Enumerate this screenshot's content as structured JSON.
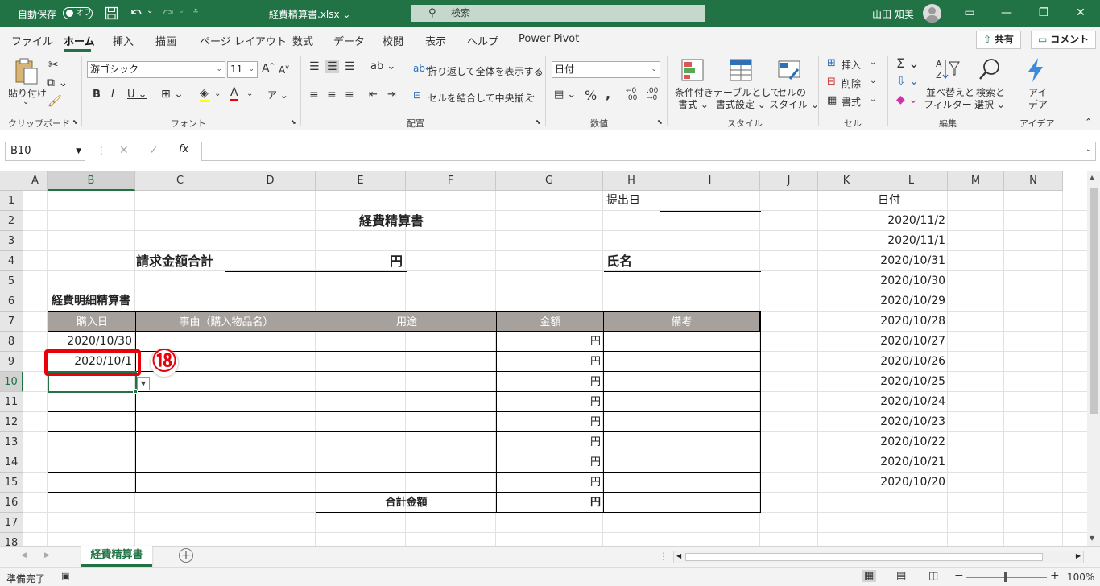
{
  "titlebar": {
    "autosave_label": "自動保存",
    "autosave_state": "オフ",
    "filename": "経費精算書.xlsx ⌄",
    "search_placeholder": "検索",
    "user_name": "山田 知美"
  },
  "tabs": [
    "ファイル",
    "ホーム",
    "挿入",
    "描画",
    "ページ レイアウト",
    "数式",
    "データ",
    "校閲",
    "表示",
    "ヘルプ",
    "Power Pivot"
  ],
  "active_tab": "ホーム",
  "share_label": "共有",
  "comment_label": "コメント",
  "ribbon": {
    "paste_label1": "貼り付け",
    "paste_label2": "⌄",
    "font_name": "游ゴシック",
    "font_size": "11",
    "wrap_text": "折り返して全体を表示する",
    "merge_center": "セルを結合して中央揃え",
    "number_format": "日付",
    "cond_format1": "条件付き",
    "cond_format2": "書式 ⌄",
    "table_format1": "テーブルとして",
    "table_format2": "書式設定 ⌄",
    "cell_style1": "セルの",
    "cell_style2": "スタイル ⌄",
    "insert": "挿入",
    "delete": "削除",
    "format": "書式",
    "sort_filter1": "並べ替えと",
    "sort_filter2": "フィルター ⌄",
    "find_select1": "検索と",
    "find_select2": "選択 ⌄",
    "ideas1": "アイ",
    "ideas2": "デア",
    "groups": {
      "clipboard": "クリップボード",
      "font": "フォント",
      "alignment": "配置",
      "number": "数値",
      "styles": "スタイル",
      "cells": "セル",
      "editing": "編集",
      "ideas": "アイデア"
    }
  },
  "formula_bar": {
    "name_box": "B10",
    "fx": "fx",
    "formula": ""
  },
  "columns": [
    "A",
    "B",
    "C",
    "D",
    "E",
    "F",
    "G",
    "H",
    "I",
    "J",
    "K",
    "L",
    "M",
    "N"
  ],
  "rows": [
    "1",
    "2",
    "3",
    "4",
    "5",
    "6",
    "7",
    "8",
    "9",
    "10",
    "11",
    "12",
    "13",
    "14",
    "15",
    "16",
    "17",
    "18"
  ],
  "selected_cell": "B10",
  "sheet": {
    "submit_date_label": "提出日",
    "title": "経費精算書",
    "total_request_label": "請求金額合計",
    "yen": "円",
    "name_label": "氏名",
    "detail_title": "経費明細精算書",
    "headers": [
      "購入日",
      "事由（購入物品名）",
      "用途",
      "金額",
      "備考"
    ],
    "purchase_dates": [
      "2020/10/30",
      "2020/10/1",
      "",
      "",
      "",
      "",
      "",
      ""
    ],
    "amount_unit": "円",
    "total_label": "合計金額",
    "total_unit": "円",
    "date_list_header": "日付",
    "date_list": [
      "2020/11/2",
      "2020/11/1",
      "2020/10/31",
      "2020/10/30",
      "2020/10/29",
      "2020/10/28",
      "2020/10/27",
      "2020/10/26",
      "2020/10/25",
      "2020/10/24",
      "2020/10/23",
      "2020/10/22",
      "2020/10/21",
      "2020/10/20"
    ]
  },
  "callout": "⑱",
  "sheet_tabs": [
    "経費精算書"
  ],
  "status": {
    "ready": "準備完了",
    "zoom": "100%"
  },
  "colors": {
    "excel_green": "#217346",
    "header_fill": "#a6a19c",
    "highlight_red": "#e8000b"
  }
}
